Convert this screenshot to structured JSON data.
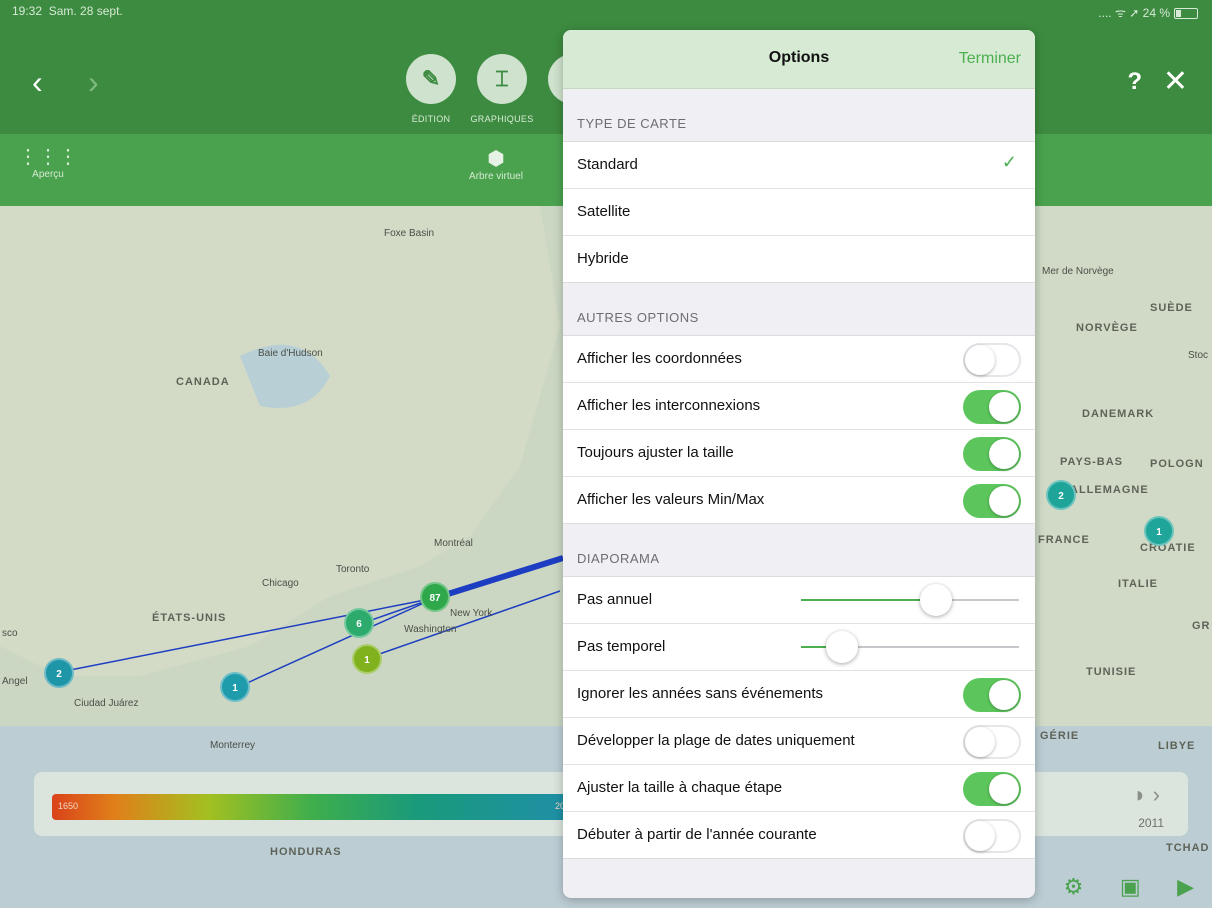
{
  "status": {
    "time": "19:32",
    "date": "Sam. 28 sept.",
    "battery": "24 %"
  },
  "nav": {
    "back_icon": "chevron-left-icon",
    "forward_icon": "chevron-right-icon",
    "edit_label": "ÉDITION",
    "charts_label": "GRAPHIQUES",
    "help": "?",
    "close": "✕"
  },
  "toolbar": {
    "overview_label": "Aperçu",
    "tree_label": "Arbre virtuel"
  },
  "map": {
    "labels": [
      "CANADA",
      "ÉTATS-UNIS",
      "SUÈDE",
      "NORVÈGE",
      "DANEMARK",
      "PAYS-BAS",
      "ALLEMAGNE",
      "POLOGN",
      "FRANCE",
      "CROATIE",
      "ITALIE",
      "TUNISIE",
      "LIBYE",
      "GÉRIE",
      "HONDURAS",
      "TCHAD",
      "GR"
    ],
    "cities": [
      "Toronto",
      "Montréal",
      "Chicago",
      "New York",
      "Washington",
      "Ciudad Juárez",
      "Monterrey",
      "Baie d'Hudson",
      "Foxe Basin",
      "Mer de Norvège",
      "Stoc",
      "Angel",
      "sco"
    ],
    "markers": [
      "87",
      "6",
      "1",
      "2",
      "1",
      "2",
      "1"
    ]
  },
  "timeline": {
    "start_year": "1650",
    "end_year_partial": "201",
    "current_year": "2011"
  },
  "popover": {
    "title": "Options",
    "done": "Terminer",
    "map_type": {
      "header": "TYPE DE CARTE",
      "options": [
        "Standard",
        "Satellite",
        "Hybride"
      ],
      "selected": "Standard"
    },
    "other": {
      "header": "AUTRES OPTIONS",
      "items": [
        {
          "label": "Afficher les coordonnées",
          "on": false
        },
        {
          "label": "Afficher les interconnexions",
          "on": true
        },
        {
          "label": "Toujours ajuster la taille",
          "on": true
        },
        {
          "label": "Afficher les valeurs Min/Max",
          "on": true
        }
      ]
    },
    "slideshow": {
      "header": "DIAPORAMA",
      "annual_step_label": "Pas annuel",
      "annual_step_value": 0.62,
      "time_step_label": "Pas temporel",
      "time_step_value": 0.19,
      "items": [
        {
          "label": "Ignorer les années sans événements",
          "on": true
        },
        {
          "label": "Développer la plage de dates uniquement",
          "on": false
        },
        {
          "label": "Ajuster la taille à chaque étape",
          "on": true
        },
        {
          "label": "Débuter à partir de l'année courante",
          "on": false
        }
      ]
    }
  }
}
